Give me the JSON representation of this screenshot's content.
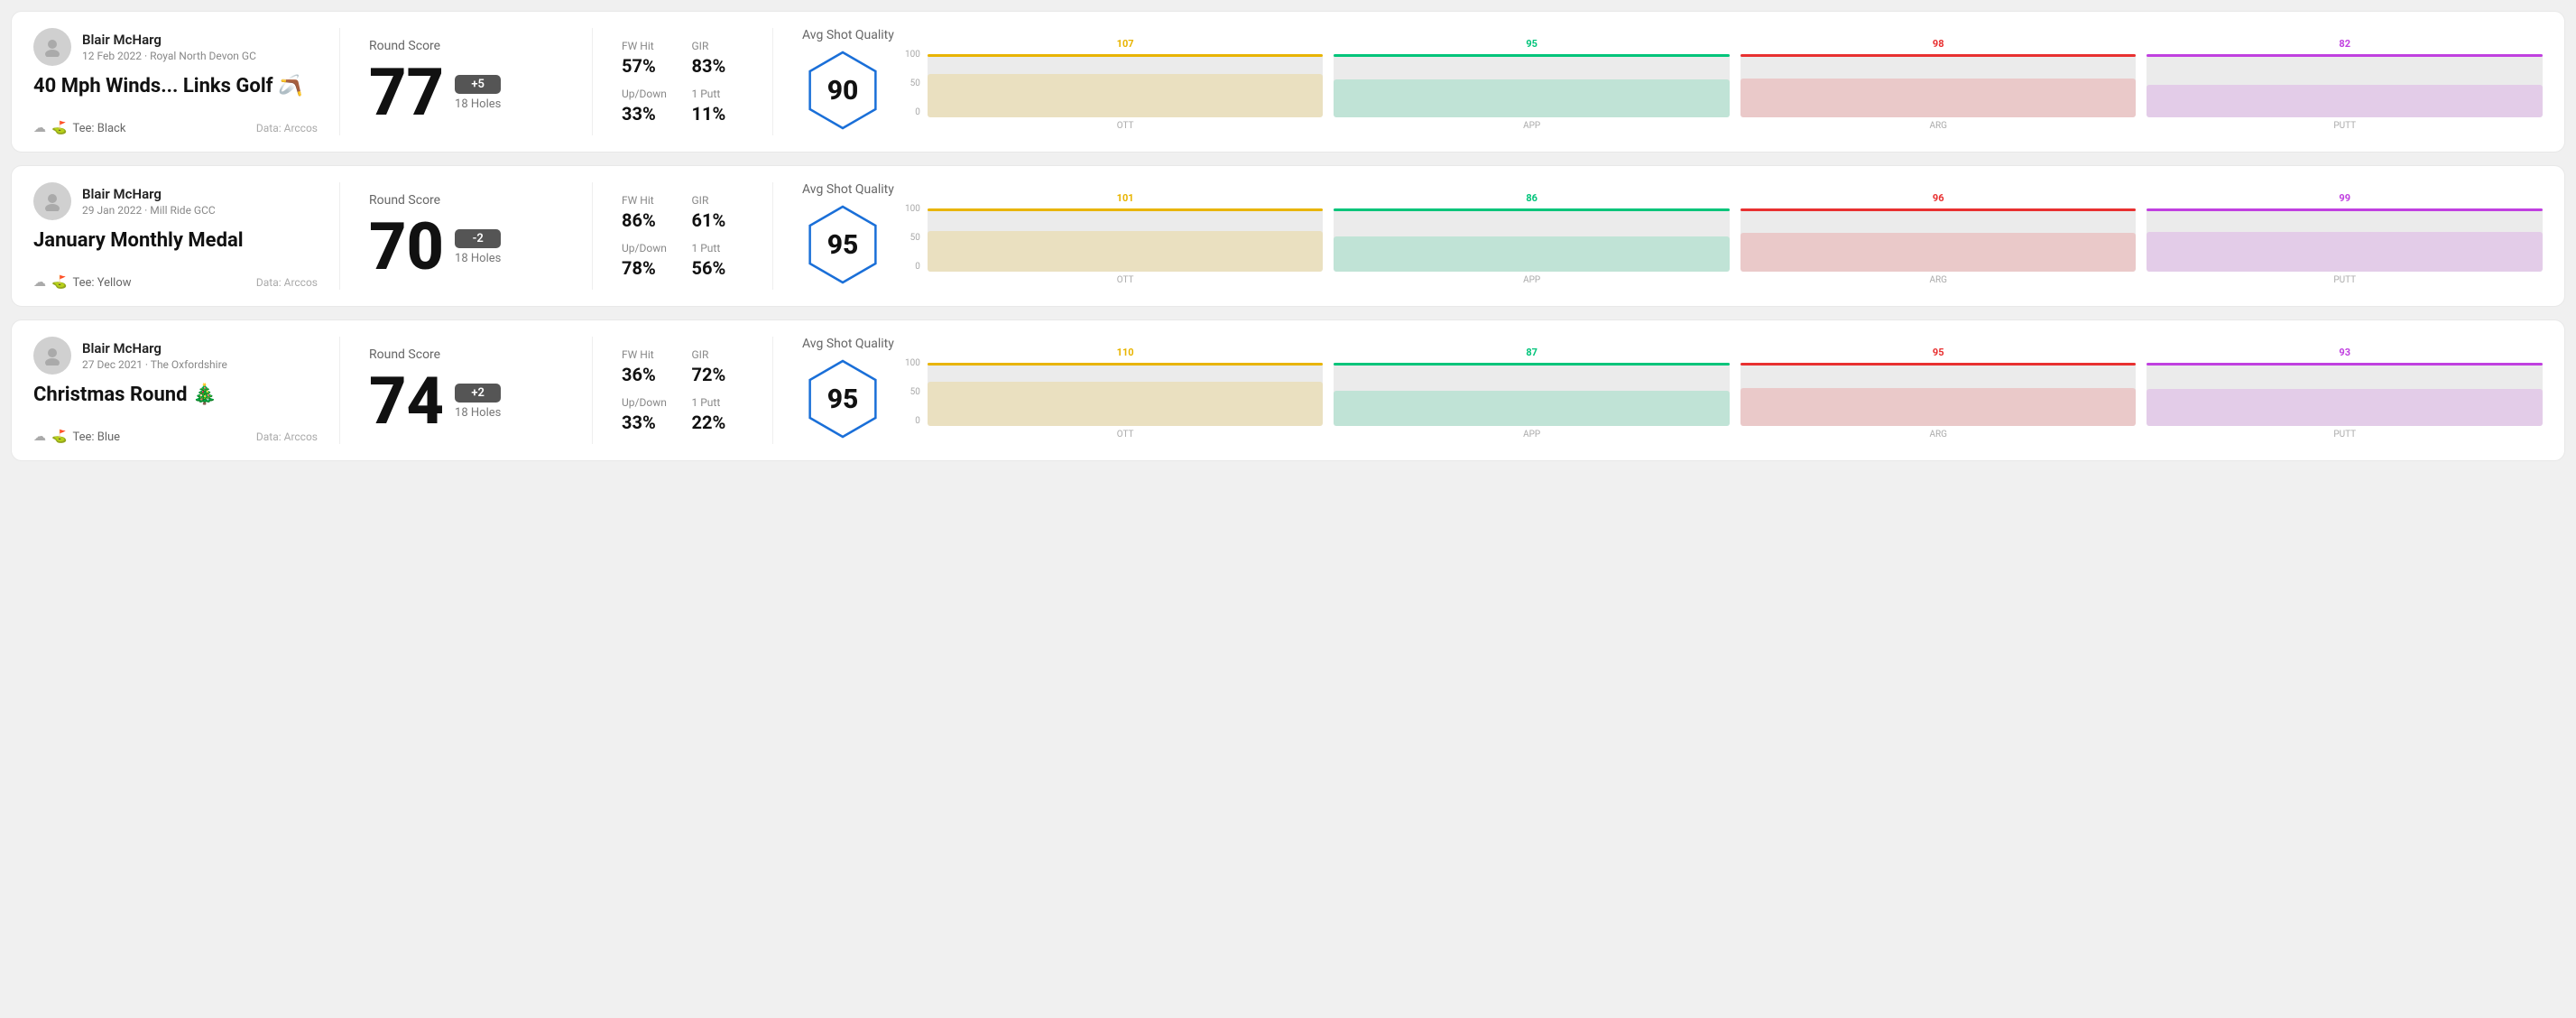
{
  "rounds": [
    {
      "id": "round1",
      "user": {
        "name": "Blair McHarg",
        "meta": "12 Feb 2022 · Royal North Devon GC"
      },
      "title": "40 Mph Winds... Links Golf 🪃",
      "tee": "Black",
      "data_source": "Data: Arccos",
      "score": "77",
      "score_diff": "+5",
      "score_diff_type": "positive",
      "holes": "18 Holes",
      "fw_hit": "57%",
      "gir": "83%",
      "up_down": "33%",
      "one_putt": "11%",
      "avg_shot_quality": "90",
      "chart": {
        "bars": [
          {
            "label": "OTT",
            "value": 107,
            "color": "#e8b400",
            "pct": 68
          },
          {
            "label": "APP",
            "value": 95,
            "color": "#00c47a",
            "pct": 60
          },
          {
            "label": "ARG",
            "value": 98,
            "color": "#e83030",
            "pct": 62
          },
          {
            "label": "PUTT",
            "value": 82,
            "color": "#c040e0",
            "pct": 52
          }
        ]
      }
    },
    {
      "id": "round2",
      "user": {
        "name": "Blair McHarg",
        "meta": "29 Jan 2022 · Mill Ride GCC"
      },
      "title": "January Monthly Medal",
      "tee": "Yellow",
      "data_source": "Data: Arccos",
      "score": "70",
      "score_diff": "-2",
      "score_diff_type": "negative",
      "holes": "18 Holes",
      "fw_hit": "86%",
      "gir": "61%",
      "up_down": "78%",
      "one_putt": "56%",
      "avg_shot_quality": "95",
      "chart": {
        "bars": [
          {
            "label": "OTT",
            "value": 101,
            "color": "#e8b400",
            "pct": 64
          },
          {
            "label": "APP",
            "value": 86,
            "color": "#00c47a",
            "pct": 55
          },
          {
            "label": "ARG",
            "value": 96,
            "color": "#e83030",
            "pct": 61
          },
          {
            "label": "PUTT",
            "value": 99,
            "color": "#c040e0",
            "pct": 63
          }
        ]
      }
    },
    {
      "id": "round3",
      "user": {
        "name": "Blair McHarg",
        "meta": "27 Dec 2021 · The Oxfordshire"
      },
      "title": "Christmas Round 🎄",
      "tee": "Blue",
      "data_source": "Data: Arccos",
      "score": "74",
      "score_diff": "+2",
      "score_diff_type": "positive",
      "holes": "18 Holes",
      "fw_hit": "36%",
      "gir": "72%",
      "up_down": "33%",
      "one_putt": "22%",
      "avg_shot_quality": "95",
      "chart": {
        "bars": [
          {
            "label": "OTT",
            "value": 110,
            "color": "#e8b400",
            "pct": 70
          },
          {
            "label": "APP",
            "value": 87,
            "color": "#00c47a",
            "pct": 55
          },
          {
            "label": "ARG",
            "value": 95,
            "color": "#e83030",
            "pct": 60
          },
          {
            "label": "PUTT",
            "value": 93,
            "color": "#c040e0",
            "pct": 59
          }
        ]
      }
    }
  ],
  "labels": {
    "round_score": "Round Score",
    "fw_hit": "FW Hit",
    "gir": "GIR",
    "up_down": "Up/Down",
    "one_putt": "1 Putt",
    "avg_shot_quality": "Avg Shot Quality",
    "tee_prefix": "Tee:",
    "y_100": "100",
    "y_50": "50",
    "y_0": "0"
  }
}
